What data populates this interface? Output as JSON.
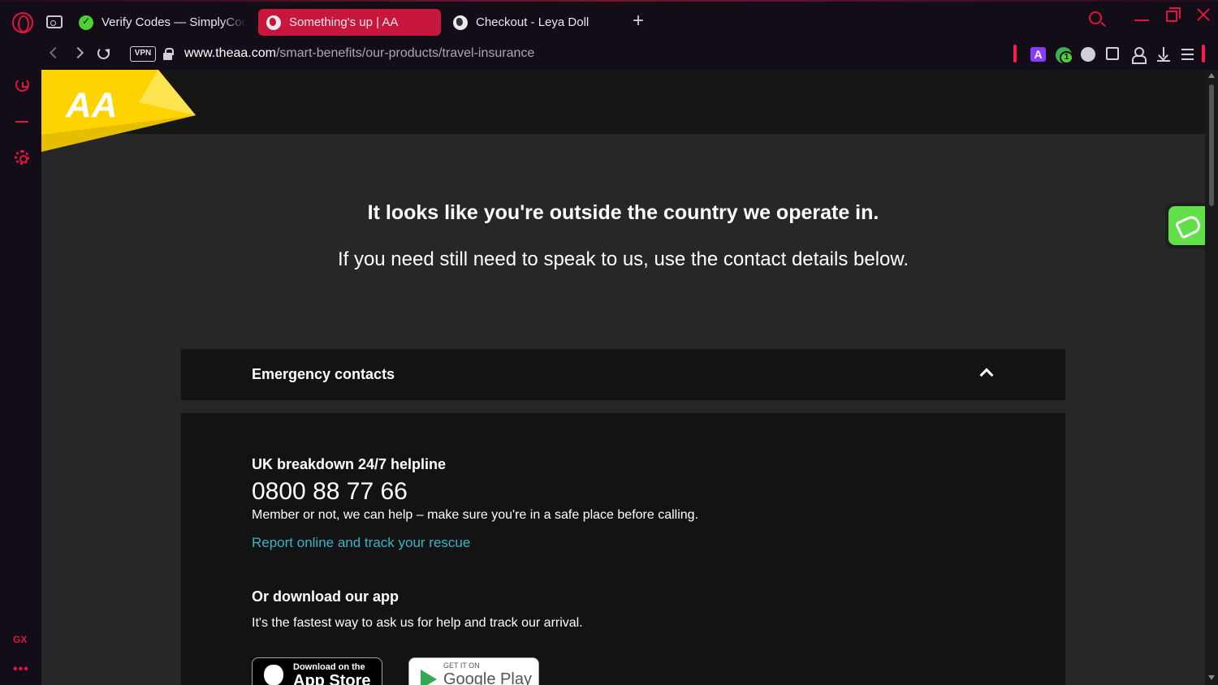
{
  "browser": {
    "tabs": [
      {
        "label": "Verify Codes — SimplyCodes",
        "icon": "simplycodes-check-icon",
        "active": false
      },
      {
        "label": "Something's up | AA",
        "icon": "globe-icon",
        "active": true
      },
      {
        "label": "Checkout - Leya Doll",
        "icon": "globe-icon",
        "active": false
      }
    ],
    "new_tab_label": "+",
    "vpn_label": "VPN",
    "url_host": "www.theaa.com",
    "url_path": "/smart-benefits/our-products/travel-insurance",
    "extension_badge": "1",
    "extension_a_label": "A",
    "sidebar_gx_label": "GX",
    "sidebar_more_label": "•••",
    "accent_color": "#e3143f"
  },
  "page": {
    "logo_text": "AA",
    "brand_yellow": "#ffd300",
    "headline": "It looks like you're outside the country we operate in.",
    "subline": "If you need still need to speak to us, use the contact details below.",
    "accordion": {
      "title": "Emergency contacts",
      "expanded": true
    },
    "helpline": {
      "heading": "UK breakdown 24/7 helpline",
      "phone": "0800 88 77 66",
      "note": "Member or not, we can help – make sure you're in a safe place before calling.",
      "link_text": "Report online and track your rescue",
      "link_color": "#3bb3c7"
    },
    "app": {
      "heading": "Or download our app",
      "note": "It's the fastest way to ask us for help and track our arrival.",
      "apple_small": "Download on the",
      "apple_big": "App Store",
      "google_small": "GET IT ON",
      "google_big": "Google Play"
    }
  }
}
